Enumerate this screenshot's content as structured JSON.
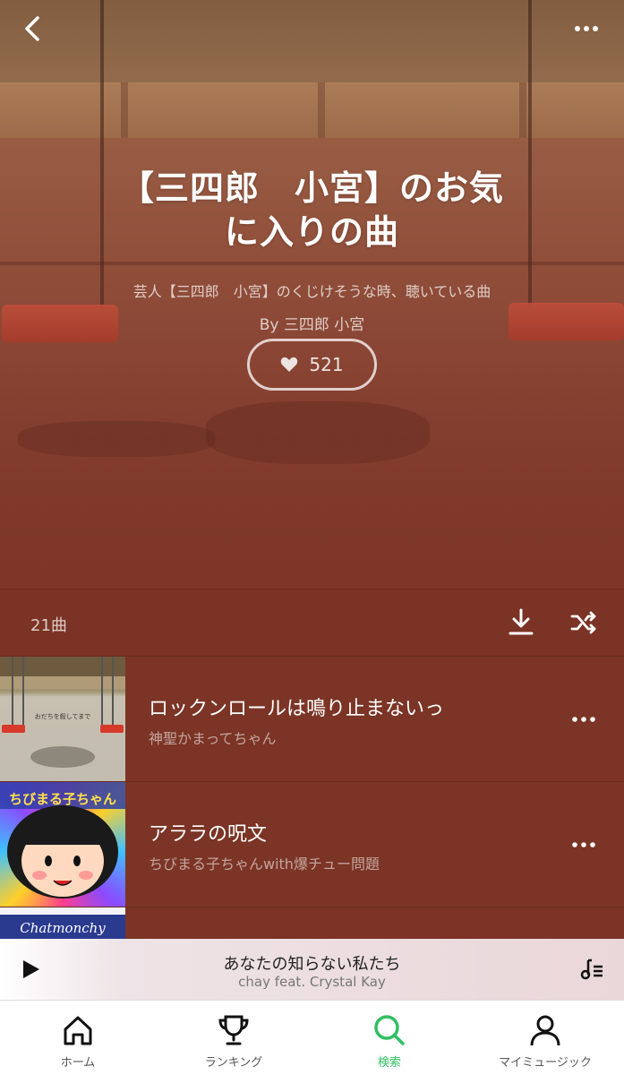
{
  "playlist": {
    "title_line1": "【三四郎　小宮】のお気",
    "title_line2": "に入りの曲",
    "description": "芸人【三四郎　小宮】のくじけそうな時、聴いている曲",
    "author": "By 三四郎 小宮",
    "likes": "521"
  },
  "list": {
    "count": "21曲"
  },
  "tracks": [
    {
      "title": "ロックンロールは鳴り止まないっ",
      "artist": "神聖かまってちゃん",
      "art_caption": "おだちを殺してまで"
    },
    {
      "title": "アララの呪文",
      "artist": "ちびまる子ちゃんwith爆チュー問題",
      "art_caption": "ちびまる子ちゃん"
    },
    {
      "art_caption": "Chatmonchy"
    }
  ],
  "now_playing": {
    "title": "あなたの知らない私たち",
    "artist": "chay feat. Crystal Kay"
  },
  "tabs": [
    {
      "label": "ホーム",
      "icon": "home-icon"
    },
    {
      "label": "ランキング",
      "icon": "trophy-icon"
    },
    {
      "label": "検索",
      "icon": "search-icon"
    },
    {
      "label": "マイミュージック",
      "icon": "person-icon"
    }
  ],
  "colors": {
    "background": "#7b3324",
    "accent": "#2fbf62"
  }
}
